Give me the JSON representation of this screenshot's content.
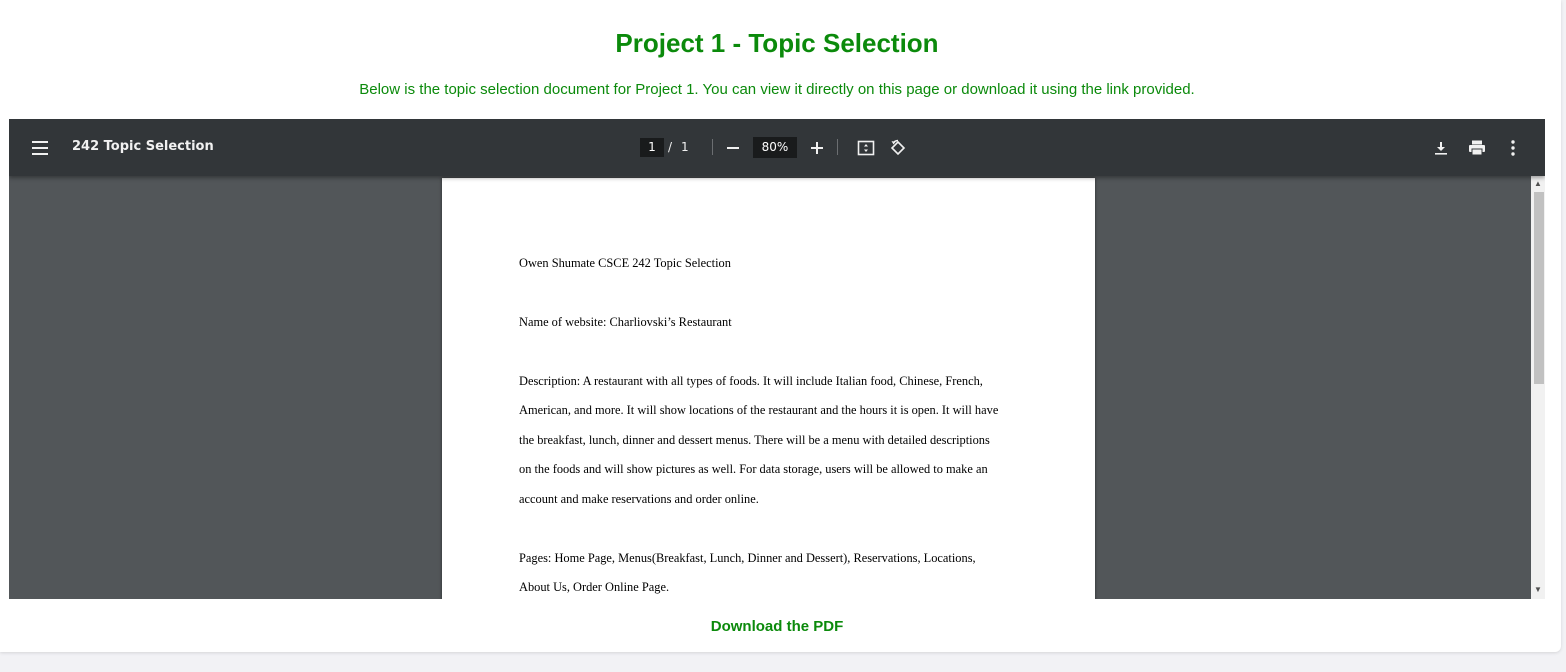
{
  "page": {
    "title": "Project 1 - Topic Selection",
    "description": "Below is the topic selection document for Project 1. You can view it directly on this page or download it using the link provided.",
    "download_link": "Download the PDF"
  },
  "viewer": {
    "doc_title": "242 Topic Selection",
    "current_page": "1",
    "page_separator": "/",
    "total_pages": "1",
    "zoom": "80%",
    "icons": [
      "menu-icon",
      "zoom-out-icon",
      "zoom-in-icon",
      "fit-page-icon",
      "rotate-icon",
      "download-icon",
      "print-icon",
      "more-options-icon"
    ]
  },
  "document": {
    "lines": [
      "Owen Shumate CSCE 242 Topic Selection",
      "Name of website: Charliovski’s Restaurant",
      "Description: A restaurant with all types of foods. It will include Italian food, Chinese, French,",
      "American, and more. It will show locations of the restaurant and the hours it is open. It will have",
      "the breakfast, lunch, dinner and dessert menus. There will be a menu with detailed descriptions",
      "on the foods and will show pictures as well. For data storage, users will be allowed to make an",
      "account and make reservations and order online.",
      "Pages: Home Page, Menus(Breakfast, Lunch, Dinner and Dessert), Reservations, Locations,",
      "About Us, Order Online Page."
    ]
  },
  "colors": {
    "accent_green": "#0b8a0b",
    "toolbar_bg": "#323639",
    "viewer_bg": "#525659"
  }
}
